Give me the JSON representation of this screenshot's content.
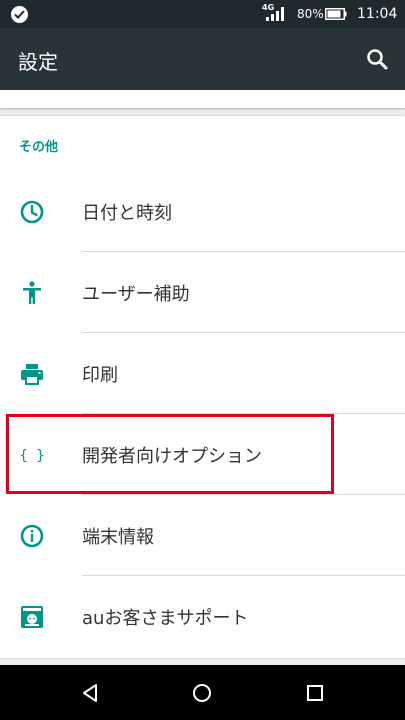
{
  "status_bar": {
    "network": "4G",
    "battery_percent": "80%",
    "time": "11:04"
  },
  "app_bar": {
    "title": "設定",
    "search_icon": "search-icon"
  },
  "section": {
    "header": "その他",
    "items": [
      {
        "label": "日付と時刻",
        "icon": "clock-icon"
      },
      {
        "label": "ユーザー補助",
        "icon": "accessibility-icon"
      },
      {
        "label": "印刷",
        "icon": "print-icon"
      },
      {
        "label": "開発者向けオプション",
        "icon": "braces-icon"
      },
      {
        "label": "端末情報",
        "icon": "info-icon"
      },
      {
        "label": "auお客さまサポート",
        "icon": "au-support-icon"
      }
    ]
  },
  "nav_bar": {
    "buttons": [
      "back-icon",
      "home-icon",
      "recents-icon"
    ]
  },
  "colors": {
    "accent": "#009688",
    "app_bar": "#27353b",
    "status_bar": "#1f2a2e",
    "highlight": "#e0001b"
  }
}
